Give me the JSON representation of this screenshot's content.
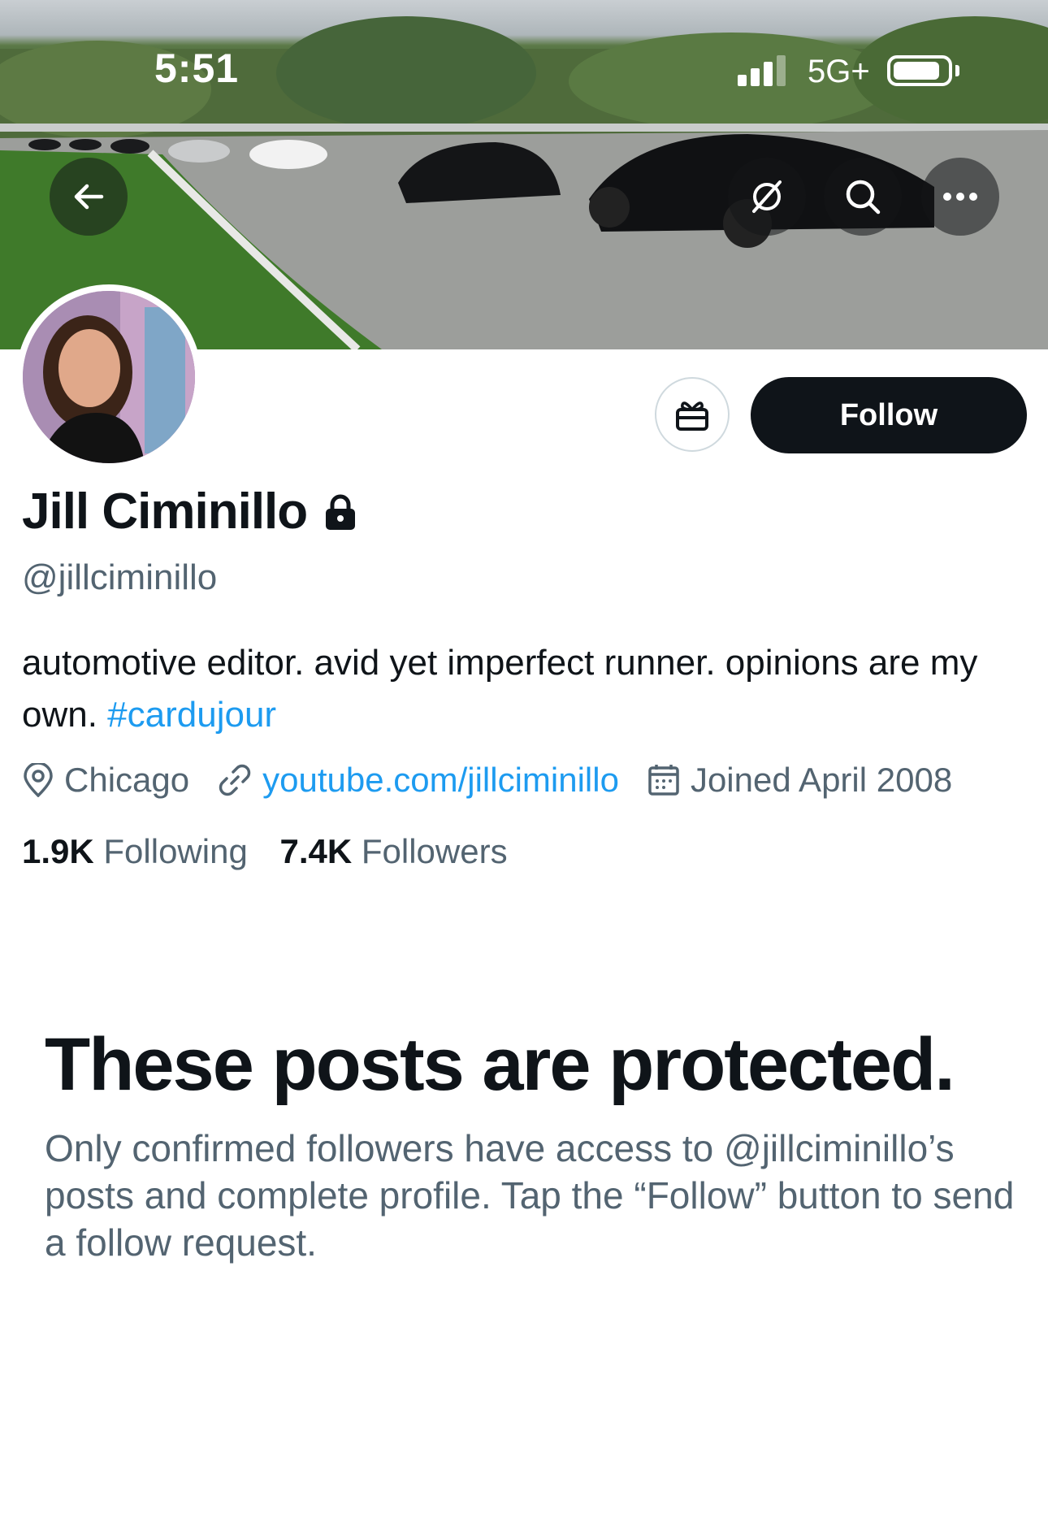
{
  "status_bar": {
    "time": "5:51",
    "network": "5G+"
  },
  "header": {
    "back_icon": "arrow-left-icon",
    "grok_icon": "grok-icon",
    "search_icon": "search-icon",
    "more_icon": "more-dots-icon"
  },
  "profile": {
    "name": "Jill Ciminillo",
    "handle": "@jillciminillo",
    "bio_text": "automotive editor. avid yet imperfect runner. opinions are my own. ",
    "bio_hashtag": "#cardujour",
    "location": "Chicago",
    "website": "youtube.com/jillciminillo",
    "joined": "Joined April 2008",
    "following_count": "1.9K",
    "following_label": "Following",
    "followers_count": "7.4K",
    "followers_label": "Followers",
    "follow_button": "Follow"
  },
  "protected": {
    "title": "These posts are protected.",
    "message": "Only confirmed followers have access to @jillciminillo’s posts and complete profile. Tap the “Follow” button to send a follow request."
  },
  "colors": {
    "accent": "#1d9bf0",
    "text": "#0f1419",
    "secondary": "#536471",
    "button": "#0f1419"
  }
}
